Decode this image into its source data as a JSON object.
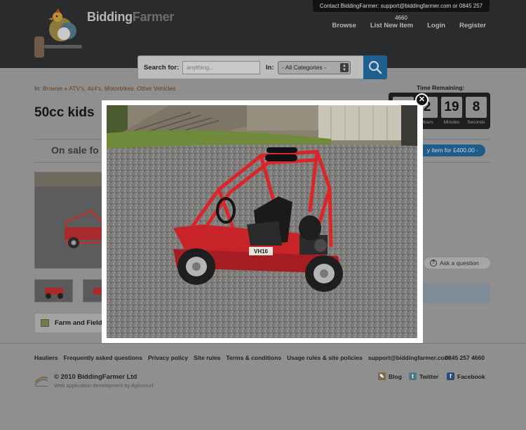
{
  "header": {
    "contact": "Contact BiddingFarmer: support@biddingfarmer.com or 0845 257 4660",
    "logo_bold": "Bidding",
    "logo_light": "Farmer",
    "nav": [
      "Browse",
      "List New Item",
      "Login",
      "Register"
    ]
  },
  "search": {
    "label": "Search for:",
    "placeholder": "anything...",
    "in_label": "In:",
    "category": "- All Categories -"
  },
  "breadcrumb": {
    "prefix": "In:",
    "browse": "Browse",
    "separator": "»",
    "category": "ATV's, 4x4's, Motorbikes, Other Vehicles"
  },
  "listing": {
    "title": "50cc kids",
    "on_sale": "On sale fo",
    "buy_label": "y item for £400.00 -",
    "ask_label": "Ask a question",
    "seller": "Farm and Field"
  },
  "countdown": {
    "label": "Time Remaining:",
    "cells": [
      {
        "value": "",
        "unit": ""
      },
      {
        "value": "2",
        "unit": "Hours"
      },
      {
        "value": "19",
        "unit": "Minutes"
      },
      {
        "value": "8",
        "unit": "Seconds"
      }
    ]
  },
  "footer": {
    "links": [
      "Hauliers",
      "Frequently asked questions",
      "Privacy policy",
      "Site rules",
      "Terms & conditions",
      "Usage rules & site policies",
      "support@biddingfarmer.com"
    ],
    "phone": "0845 257 4660",
    "copyright": "© 2010 BiddingFarmer Ltd",
    "credit": "Web application development by Agincourt",
    "social": [
      "Blog",
      "Twitter",
      "Facebook"
    ]
  },
  "lightbox": {
    "close_symbol": "✕",
    "plate_text": "VH16"
  },
  "colors": {
    "header_bg": "#2a2b2d",
    "accent_blue": "#1d5f8e",
    "link_brown": "#6b3d1a",
    "buggy_red": "#d8262b"
  }
}
